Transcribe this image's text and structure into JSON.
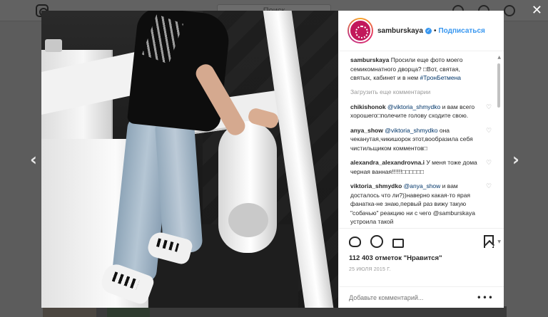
{
  "background": {
    "search_placeholder": "Поиск"
  },
  "post": {
    "username": "samburskaya",
    "follow_label": "Подписаться",
    "separator": "•",
    "caption_user": "samburskaya",
    "caption_text": "Просили еще фото моего семикомнатного дворца? □Вот, святая, святых, кабинет и в нем",
    "caption_tag": "#ТронБетмена",
    "load_more": "Загрузить еще комментарии",
    "likes": "112 403 отметок \"Нравится\"",
    "date": "25 ИЮЛЯ 2015 Г.",
    "comment_placeholder": "Добавьте комментарий...",
    "more": "•••"
  },
  "comments": [
    {
      "user": "chikishonok",
      "mention": "@viktoria_shmydko",
      "text": " и вам всего хорошего□полечите голову сходите свою."
    },
    {
      "user": "anya_show",
      "mention": "@viktoria_shmydko",
      "text": " она чеканутая,чикишорок этот,вообразила себя чистильщиком комментов□"
    },
    {
      "user": "alexandra_alexandrovna.i",
      "mention": "",
      "text": " У меня тоже дома черная ванная!!!!!!□□□□□□"
    },
    {
      "user": "viktoria_shmydko",
      "mention": "@anya_show",
      "text": " и вам досталось что ли?))наверно какая-то ярая фанатка-не знаю,первый раз вижу такую \"собачью\" реакцию ни с чего @samburskaya устроила такой"
    }
  ],
  "icons": {
    "verified": "✓",
    "heart": "♡",
    "prev": "‹",
    "next": "›",
    "close": "✕",
    "scroll_up": "▲",
    "scroll_down": "▼"
  },
  "colors": {
    "link": "#3897f0",
    "mention": "#003569",
    "muted": "#999999"
  }
}
